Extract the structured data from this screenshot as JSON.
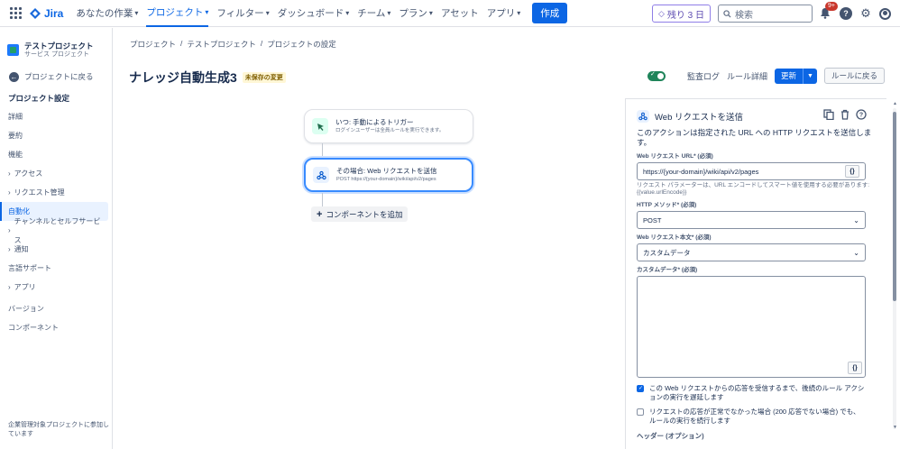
{
  "topnav": {
    "logo": "Jira",
    "items": [
      {
        "label": "あなたの作業",
        "dropdown": true
      },
      {
        "label": "プロジェクト",
        "dropdown": true,
        "active": true
      },
      {
        "label": "フィルター",
        "dropdown": true
      },
      {
        "label": "ダッシュボード",
        "dropdown": true
      },
      {
        "label": "チーム",
        "dropdown": true
      },
      {
        "label": "プラン",
        "dropdown": true
      },
      {
        "label": "アセット",
        "dropdown": false
      },
      {
        "label": "アプリ",
        "dropdown": true
      }
    ],
    "create": "作成",
    "trial": "残り 3 日",
    "search_placeholder": "検索",
    "notif_badge": "9+"
  },
  "sidebar": {
    "project_name": "テストプロジェクト",
    "project_type": "サービス プロジェクト",
    "back_label": "プロジェクトに戻る",
    "section_title": "プロジェクト設定",
    "items": [
      {
        "label": "詳細",
        "expand": false
      },
      {
        "label": "要約",
        "expand": false
      },
      {
        "label": "機能",
        "expand": false
      },
      {
        "label": "アクセス",
        "expand": true
      },
      {
        "label": "リクエスト管理",
        "expand": true
      },
      {
        "label": "自動化",
        "expand": false,
        "active": true
      },
      {
        "label": "チャンネルとセルフサービス",
        "expand": true
      },
      {
        "label": "通知",
        "expand": true
      },
      {
        "label": "言語サポート",
        "expand": false
      },
      {
        "label": "アプリ",
        "expand": true
      }
    ],
    "items2": [
      {
        "label": "バージョン"
      },
      {
        "label": "コンポーネント"
      }
    ],
    "footer": "企業管理対象プロジェクトに参加しています"
  },
  "breadcrumb": [
    "プロジェクト",
    "テストプロジェクト",
    "プロジェクトの設定"
  ],
  "page": {
    "title": "ナレッジ自動生成3",
    "unsaved": "未保存の変更"
  },
  "actions": {
    "audit_log": "監査ログ",
    "rule_details": "ルール詳細",
    "update": "更新",
    "back_to_rules": "ルールに戻る"
  },
  "flow": {
    "trigger_title": "いつ: 手動によるトリガー",
    "trigger_sub": "ログインユーザーは全員ルールを実行できます。",
    "action_title": "その場合: Web リクエストを送信",
    "action_sub": "POST https://{your-domain}/wiki/api/v2/pages",
    "add_component": "コンポーネントを追加"
  },
  "panel": {
    "title": "Web リクエストを送信",
    "description": "このアクションは指定された URL への HTTP リクエストを送信します。",
    "url_label": "Web リクエスト URL* (必須)",
    "url_value": "https://{your-domain}/wiki/api/v2/pages",
    "url_help_1": "リクエスト パラメーターは、URL エンコードしてスマート値を使用する必要があります:",
    "url_help_2": "{{value.urlEncode}}",
    "method_label": "HTTP メソッド* (必須)",
    "method_value": "POST",
    "body_label": "Web リクエスト本文* (必須)",
    "body_value": "カスタムデータ",
    "custom_label": "カスタムデータ* (必須)",
    "check1": "この Web リクエストからの応答を受信するまで、後続のルール アクションの実行を遅延します",
    "check2": "リクエストの応答が正常でなかった場合 (200 応答でない場合) でも、ルールの実行を続行します",
    "headers_label": "ヘッダー (オプション)",
    "smart_btn": "{}"
  }
}
